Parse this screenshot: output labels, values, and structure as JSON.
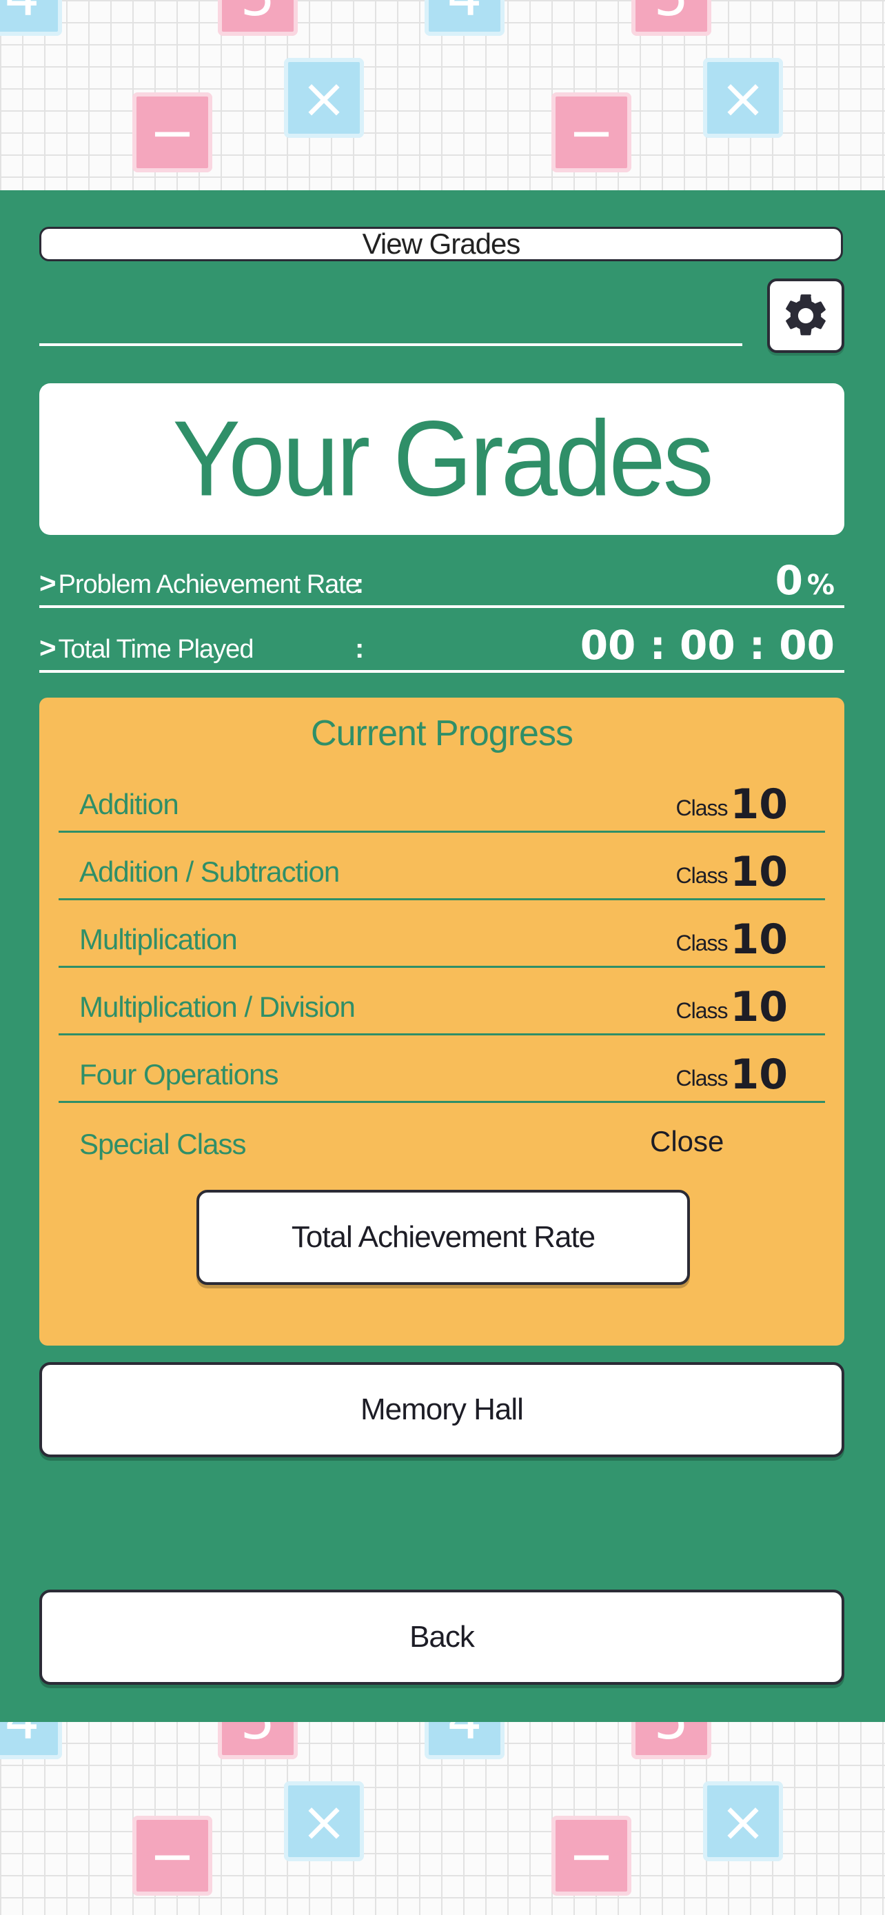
{
  "background": {
    "tiles_top": [
      {
        "kind": "blue",
        "glyph": "4"
      },
      {
        "kind": "pink",
        "glyph": "5"
      },
      {
        "kind": "pink",
        "glyph": "+"
      },
      {
        "kind": "blue",
        "glyph": "4"
      },
      {
        "kind": "pink",
        "glyph": "5"
      },
      {
        "kind": "pink",
        "glyph": "+"
      },
      {
        "kind": "blue",
        "glyph": "×"
      },
      {
        "kind": "pink",
        "glyph": "−"
      },
      {
        "kind": "blue",
        "glyph": "×"
      },
      {
        "kind": "pink",
        "glyph": "−"
      }
    ],
    "colors": {
      "pink": "#f4a6bd",
      "blue": "#aee0f3",
      "panel": "#33956e",
      "progress": "#f8bd59",
      "green_text": "#2f8f68"
    }
  },
  "header": {
    "title": "View Grades",
    "settings_icon": "gear-icon"
  },
  "grades_card": {
    "title": "Your Grades"
  },
  "stats": {
    "achievement_label": "Problem Achievement Rate",
    "achievement_value": "0",
    "achievement_unit": "%",
    "time_label": "Total Time Played",
    "time_value": "00 : 00 : 00",
    "colon": ":",
    "arrow": ">"
  },
  "progress": {
    "heading": "Current Progress",
    "class_prefix": "Class",
    "rows": [
      {
        "name": "Addition",
        "value": "10"
      },
      {
        "name": "Addition / Subtraction",
        "value": "10"
      },
      {
        "name": "Multiplication",
        "value": "10"
      },
      {
        "name": "Multiplication / Division",
        "value": "10"
      },
      {
        "name": "Four Operations",
        "value": "10"
      }
    ],
    "special": {
      "name": "Special Class",
      "status": "Close"
    },
    "total_button": "Total Achievement Rate"
  },
  "buttons": {
    "memory_hall": "Memory Hall",
    "back": "Back"
  }
}
